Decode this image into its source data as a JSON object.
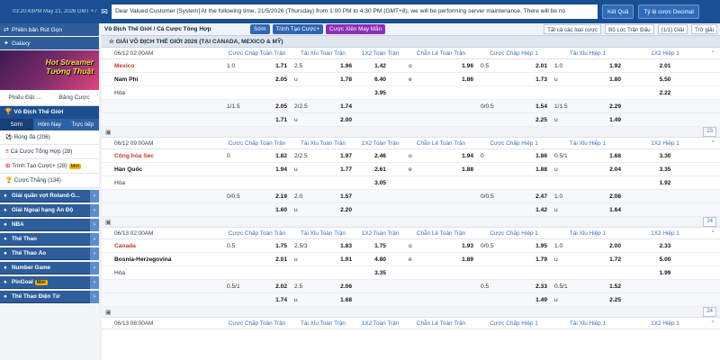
{
  "topbar": {
    "time": "03:20:43PM May 21, 2026 GMT +7",
    "mail_icon": "mail-icon",
    "notice": "Dear Valued Customer [System] At the following time, 21/5/2026 (Thursday) from 1:00 PM to 4:30 PM (GMT+8), we will be performing server maintenance. There will be no",
    "results_label": "Kết Quả",
    "odds_format_label": "Tỷ lệ cược Decimal"
  },
  "sidebar": {
    "top_buttons": [
      "Phiên bản Rút Gọn",
      "Galaxy"
    ],
    "banner_text": [
      "Hot Streamer",
      "Tướng Thuật"
    ],
    "tabs": [
      "Phiếu Đặt ...",
      "Bảng Cược"
    ],
    "section_title": "Vô Địch Thế Giới",
    "subtabs": [
      "Sớm",
      "Hôm Nay",
      "Trực tiếp"
    ],
    "items": [
      {
        "label": "Bóng đá (206)",
        "badge": ""
      },
      {
        "label": "Cá Cược Tổng Hợp (28)",
        "badge": ""
      },
      {
        "label": "Trình Tạo Cược+ (28)",
        "badge": "Mới"
      },
      {
        "label": "Cược Thắng (134)",
        "badge": ""
      }
    ],
    "categories": [
      {
        "label": "Giải quần vợt Roland-G...",
        "badge": ""
      },
      {
        "label": "Giải Ngoại hạng Ấn Độ",
        "badge": ""
      },
      {
        "label": "NBA",
        "badge": ""
      },
      {
        "label": "Thể Thao",
        "badge": ""
      },
      {
        "label": "Thể Thao Ảo",
        "badge": ""
      },
      {
        "label": "Number Game",
        "badge": ""
      },
      {
        "label": "PinGoal",
        "badge": "Mới"
      },
      {
        "label": "Thể Thao Điện Tử",
        "badge": ""
      }
    ]
  },
  "toolbar": {
    "breadcrumb": "Vô Địch Thế Giới / Cá Cược Tổng Hợp",
    "pill_early": "Sớm",
    "pill_builder": "Trình Tạo Cược+",
    "pill_parlay": "Cược Xiên May Mắn",
    "all_bets": "Tất cả các loại cược",
    "filter": "Bộ Lọc Trận Đấu",
    "pages": "(1/1) Giải",
    "refresh": "Trở giải"
  },
  "league": "GIẢI VÔ ĐỊCH THẾ GIỚI 2026 (TẠI CANADA, MEXICO & MỸ)",
  "columns": [
    "Cược Chấp Toàn Trận",
    "Tài Xỉu Toàn Trận",
    "1X2 Toàn Trận",
    "Chẵn Lẻ Toàn Trận",
    "Cược Chấp Hiệp 1",
    "Tài Xỉu Hiệp 1",
    "1X2 Hiệp 1"
  ],
  "matches": [
    {
      "datetime": "06/12 02:00AM",
      "home": "Mexico",
      "away": "Nam Phi",
      "draw": "Hòa",
      "count": "23",
      "rows": [
        [
          [
            "1.0",
            "1.71"
          ],
          [
            "2.5",
            "1.96"
          ],
          [
            "",
            "1.42"
          ],
          [
            "o",
            "1.96"
          ],
          [
            "0.5",
            "2.01"
          ],
          [
            "1.0",
            "1.92"
          ],
          [
            "",
            "2.01"
          ]
        ],
        [
          [
            "",
            "2.05"
          ],
          [
            "u",
            "1.78"
          ],
          [
            "",
            "6.40"
          ],
          [
            "e",
            "1.86"
          ],
          [
            "",
            "1.73"
          ],
          [
            "u",
            "1.80"
          ],
          [
            "",
            "5.50"
          ]
        ],
        [
          [
            "",
            ""
          ],
          [
            "",
            ""
          ],
          [
            "",
            "3.95"
          ],
          [
            "",
            ""
          ],
          [
            "",
            ""
          ],
          [
            "",
            ""
          ],
          [
            "",
            "2.22"
          ]
        ]
      ],
      "sub": [
        [
          [
            "1/1.5",
            "2.05"
          ],
          [
            "2/2.5",
            "1.74"
          ],
          [
            "",
            ""
          ],
          [
            "",
            ""
          ],
          [
            "0/0.5",
            "1.54"
          ],
          [
            "1/1.5",
            "2.29"
          ],
          [
            "",
            ""
          ]
        ],
        [
          [
            "",
            "1.71"
          ],
          [
            "u",
            "2.00"
          ],
          [
            "",
            ""
          ],
          [
            "",
            ""
          ],
          [
            "",
            "2.25"
          ],
          [
            "u",
            "1.49"
          ],
          [
            "",
            ""
          ]
        ]
      ]
    },
    {
      "datetime": "06/12 09:00AM",
      "home": "Cộng hòa Séc",
      "away": "Hàn Quốc",
      "draw": "Hòa",
      "count": "24",
      "rows": [
        [
          [
            "0",
            "1.82"
          ],
          [
            "2/2.5",
            "1.97"
          ],
          [
            "",
            "2.46"
          ],
          [
            "o",
            "1.94"
          ],
          [
            "0",
            "1.86"
          ],
          [
            "0.5/1",
            "1.68"
          ],
          [
            "",
            "3.30"
          ]
        ],
        [
          [
            "",
            "1.94"
          ],
          [
            "u",
            "1.77"
          ],
          [
            "",
            "2.61"
          ],
          [
            "e",
            "1.88"
          ],
          [
            "",
            "1.88"
          ],
          [
            "u",
            "2.04"
          ],
          [
            "",
            "3.35"
          ]
        ],
        [
          [
            "",
            ""
          ],
          [
            "",
            ""
          ],
          [
            "",
            "3.05"
          ],
          [
            "",
            ""
          ],
          [
            "",
            ""
          ],
          [
            "",
            ""
          ],
          [
            "",
            "1.92"
          ]
        ]
      ],
      "sub": [
        [
          [
            "0/0.5",
            "2.19"
          ],
          [
            "2.0",
            "1.57"
          ],
          [
            "",
            ""
          ],
          [
            "",
            ""
          ],
          [
            "0/0.5",
            "2.47"
          ],
          [
            "1.0",
            "2.08"
          ],
          [
            "",
            ""
          ]
        ],
        [
          [
            "",
            "1.60"
          ],
          [
            "u",
            "2.20"
          ],
          [
            "",
            ""
          ],
          [
            "",
            ""
          ],
          [
            "",
            "1.42"
          ],
          [
            "u",
            "1.64"
          ],
          [
            "",
            ""
          ]
        ]
      ]
    },
    {
      "datetime": "06/13 02:00AM",
      "home": "Canada",
      "away": "Bosnia-Herzegovina",
      "draw": "Hòa",
      "count": "24",
      "rows": [
        [
          [
            "0.5",
            "1.75"
          ],
          [
            "2.5/3",
            "1.83"
          ],
          [
            "",
            "1.75"
          ],
          [
            "o",
            "1.93"
          ],
          [
            "0/0.5",
            "1.95"
          ],
          [
            "1.0",
            "2.00"
          ],
          [
            "",
            "2.33"
          ]
        ],
        [
          [
            "",
            "2.01"
          ],
          [
            "u",
            "1.91"
          ],
          [
            "",
            "4.80"
          ],
          [
            "e",
            "1.89"
          ],
          [
            "",
            "1.79"
          ],
          [
            "u",
            "1.72"
          ],
          [
            "",
            "5.00"
          ]
        ],
        [
          [
            "",
            ""
          ],
          [
            "",
            ""
          ],
          [
            "",
            "3.35"
          ],
          [
            "",
            ""
          ],
          [
            "",
            ""
          ],
          [
            "",
            ""
          ],
          [
            "",
            "1.99"
          ]
        ]
      ],
      "sub": [
        [
          [
            "0.5/1",
            "2.02"
          ],
          [
            "2.5",
            "2.06"
          ],
          [
            "",
            ""
          ],
          [
            "",
            ""
          ],
          [
            "0.5",
            "2.33"
          ],
          [
            "0.5/1",
            "1.52"
          ],
          [
            "",
            ""
          ]
        ],
        [
          [
            "",
            "1.74"
          ],
          [
            "u",
            "1.68"
          ],
          [
            "",
            ""
          ],
          [
            "",
            ""
          ],
          [
            "",
            "1.49"
          ],
          [
            "u",
            "2.25"
          ],
          [
            "",
            ""
          ]
        ]
      ]
    },
    {
      "datetime": "06/13 08:00AM",
      "home": "",
      "away": "",
      "draw": "",
      "count": "",
      "rows": [],
      "sub": []
    }
  ]
}
